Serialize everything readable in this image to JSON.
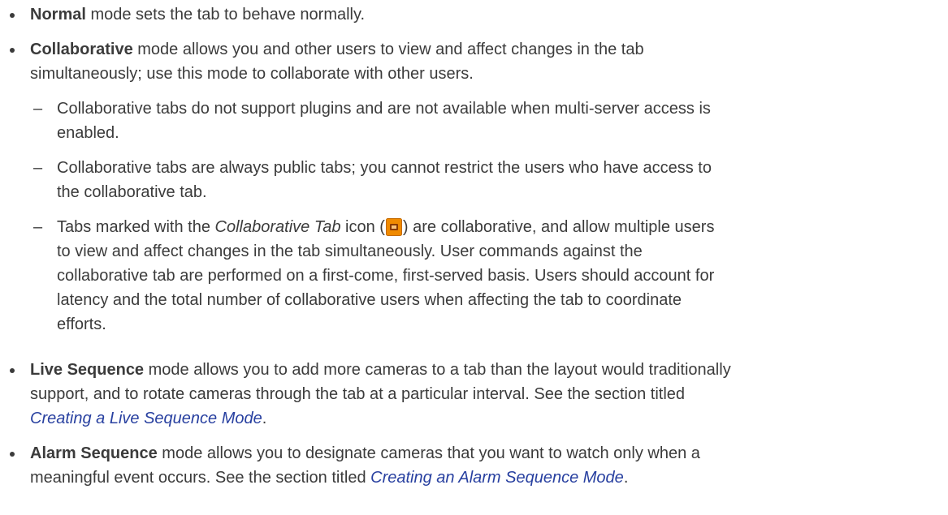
{
  "items": [
    {
      "term": "Normal",
      "rest": " mode sets the tab to behave normally."
    },
    {
      "term": "Collaborative",
      "line1": " mode allows you and other users to view and affect changes in the tab",
      "line2": "simultaneously; use this mode to collaborate with other users.",
      "subitems": [
        {
          "dash": "–",
          "line1": "Collaborative tabs do not support plugins and are not available when multi-server access is",
          "line2": "enabled."
        },
        {
          "dash": "–",
          "line1": "Collaborative tabs are always public tabs; you cannot restrict the users who have access to",
          "line2": "the collaborative tab."
        },
        {
          "dash": "–",
          "pre": "Tabs marked with the ",
          "italic": "Collaborative Tab",
          "mid": " icon (",
          "post": ") are collaborative, and allow multiple users",
          "line2": "to view and affect changes in the tab simultaneously. User commands against the",
          "line3": "collaborative tab are performed on a first-come, first-served basis. Users should account for",
          "line4": "latency and the total number of collaborative users when affecting the tab to coordinate",
          "line5": "efforts.",
          "icon": "collaborative-tab-icon"
        }
      ]
    },
    {
      "term": "Live Sequence",
      "line1": " mode allows you to add more cameras to a tab than the layout would traditionally",
      "line2": "support, and to rotate cameras through the tab at a particular interval. See the section titled",
      "link": "Creating a Live Sequence Mode",
      "after": "."
    },
    {
      "term": "Alarm Sequence",
      "line1": " mode allows you to designate cameras that you want to watch only when a",
      "line2": "meaningful event occurs. See the section titled ",
      "link": "Creating an Alarm Sequence Mode",
      "after": "."
    }
  ],
  "colors": {
    "text": "#3b3b3b",
    "link": "#2840a0",
    "icon_orange": "#f08a00",
    "icon_inner": "#8a3a00"
  }
}
